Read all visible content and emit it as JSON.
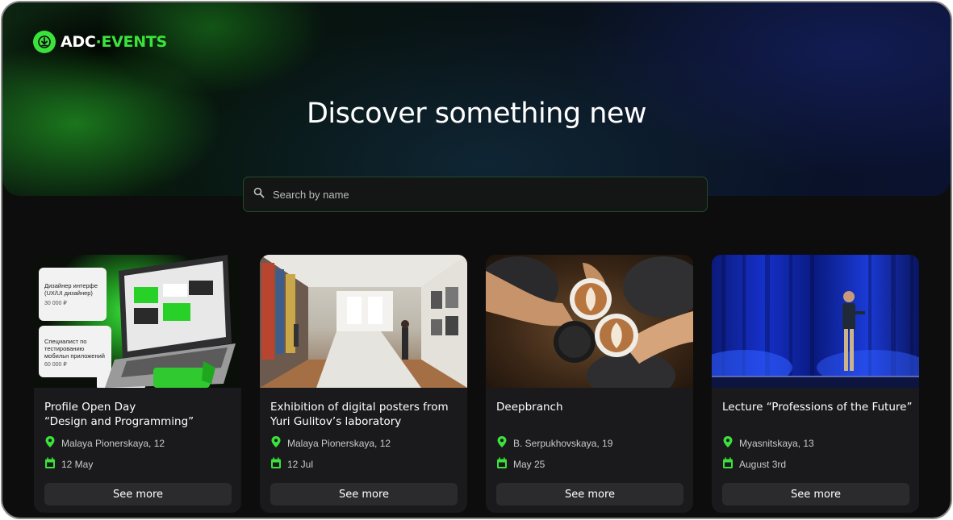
{
  "brand": {
    "logo_text_a": "ADC",
    "logo_text_dot": "·",
    "logo_text_b": "EVENTS",
    "accent": "#3be23b"
  },
  "hero": {
    "headline": "Discover something new"
  },
  "search": {
    "placeholder": "Search by name",
    "value": ""
  },
  "cards": [
    {
      "title_line1": "Profile Open Day",
      "title_line2": "“Design and Programming”",
      "location": "Malaya Pionerskaya, 12",
      "date": "12 May",
      "button": "See more",
      "image_text": {
        "tile1_title": "Дизайнер интерфе (UX/UI дизайнер)",
        "tile1_price": "30 000 ₽",
        "tile2_title": "Специалист по тестированию мобильн приложений",
        "tile2_price": "60 000 ₽"
      }
    },
    {
      "title_line1": "Exhibition of digital posters from",
      "title_line2": "Yuri Gulitov’s laboratory",
      "location": "Malaya Pionerskaya, 12",
      "date": "12 Jul",
      "button": "See more"
    },
    {
      "title_line1": "Deepbranch",
      "title_line2": "",
      "location": "B. Serpukhovskaya, 19",
      "date": "May 25",
      "button": "See more"
    },
    {
      "title_line1": "Lecture “Professions of the Future”",
      "title_line2": "",
      "location": "Myasnitskaya, 13",
      "date": "August 3rd",
      "button": "See more"
    }
  ],
  "icons": {
    "search": "search-icon",
    "location": "location-pin-icon",
    "date": "calendar-icon"
  }
}
